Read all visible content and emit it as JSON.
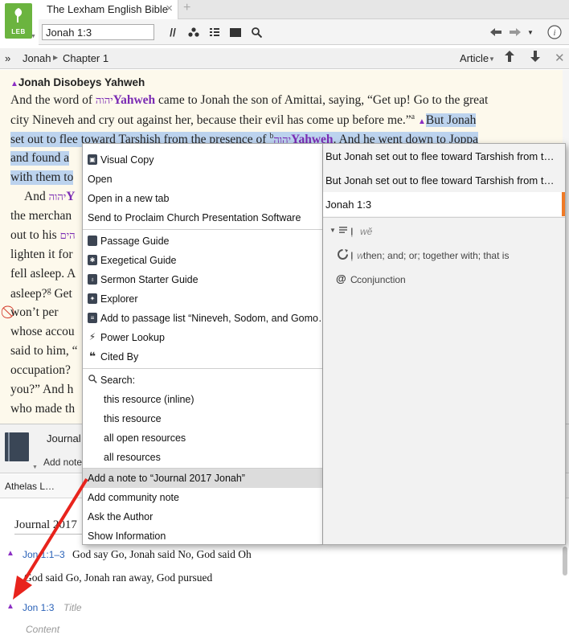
{
  "app": {
    "logo_label": "LEB"
  },
  "tab": {
    "title": "The Lexham English Bible",
    "close": "×",
    "add": "+"
  },
  "toolbar": {
    "reference_value": "Jonah 1:3",
    "parallel_icon": "//",
    "help_icon": "i"
  },
  "crumbs": {
    "collapse": "»",
    "book": "Jonah",
    "chapter": "Chapter 1",
    "article": "Article"
  },
  "bible": {
    "heading": "Jonah Disobeys Yahweh",
    "l1a": "And the word of ",
    "yhwh_heb": "יהוה",
    "yhwh": "Yahweh",
    "l1b": " came to Jonah the son of Amittai, saying, “Get up! Go to the great",
    "l2a": "city Nineveh and cry out against her, because their evil has come up ",
    "l2b": "before me",
    "l2c": ".”",
    "l2d": "But Jonah",
    "sup_a": "a",
    "sup_b": "b",
    "sup_g": "g",
    "l3a": "set out to flee toward Tarshish from ",
    "l3b": "the presence of",
    "l3c": ". And he went down to Joppa",
    "l4": "and found a",
    "l5": "with them to",
    "l6a": "And ",
    "l6b": "Y",
    "l7": "the merchan",
    "l8a": "out to his ",
    "l8b": "הים",
    "l9": "lighten it for",
    "l10": "fell asleep. A",
    "l11": "asleep?",
    "l11b": " Get",
    "l12": "won’t per",
    "l13": "whose accou",
    "l14": "said to him, “",
    "l15": "occupation?",
    "l16": "you?” And h",
    "l17": "who made th"
  },
  "journal": {
    "tab_label": "Journal",
    "add_note": "Add note",
    "font_select": "Athelas L…",
    "title_value": "Journal 2017",
    "notes": [
      {
        "ref": "Jon 1:1–3",
        "title": "God say Go, Jonah said No, God said Oh",
        "body": "God said Go, Jonah ran away, God pursued"
      },
      {
        "ref": "Jon 1:3",
        "title_placeholder": "Title",
        "content_placeholder": "Content"
      }
    ]
  },
  "menu": {
    "items": [
      "Visual Copy",
      "Open",
      "Open in a new tab",
      "Send to Proclaim Church Presentation Software",
      "Passage Guide",
      "Exegetical Guide",
      "Sermon Starter Guide",
      "Explorer",
      "Add to passage list “Nineveh, Sodom, and Gomo…",
      "Power Lookup",
      "Cited By",
      "Search:",
      "this resource (inline)",
      "this resource",
      "all open resources",
      "all resources",
      "Add a note to “Journal 2017 Jonah”",
      "Add community note",
      "Ask the Author",
      "Show Information"
    ]
  },
  "side": {
    "sel1": "But Jonah set out to flee toward Tarshish from t…",
    "sel2": "But Jonah set out to flee toward Tarshish from t…",
    "ref": "Jonah 1:3",
    "word_heb": "וְ",
    "word_translit": "wĕ",
    "gloss_heb": "וְ",
    "gloss_translit": "w",
    "gloss": " then; and; or; together with; that is",
    "pos_mark": "C",
    "pos": " conjunction"
  },
  "colors": {
    "accent_purple": "#7a2bb3",
    "selection": "#bcd3ee",
    "logo_green": "#6bb43f",
    "arrow_red": "#e8231c",
    "ref_accent": "#f07a26"
  }
}
